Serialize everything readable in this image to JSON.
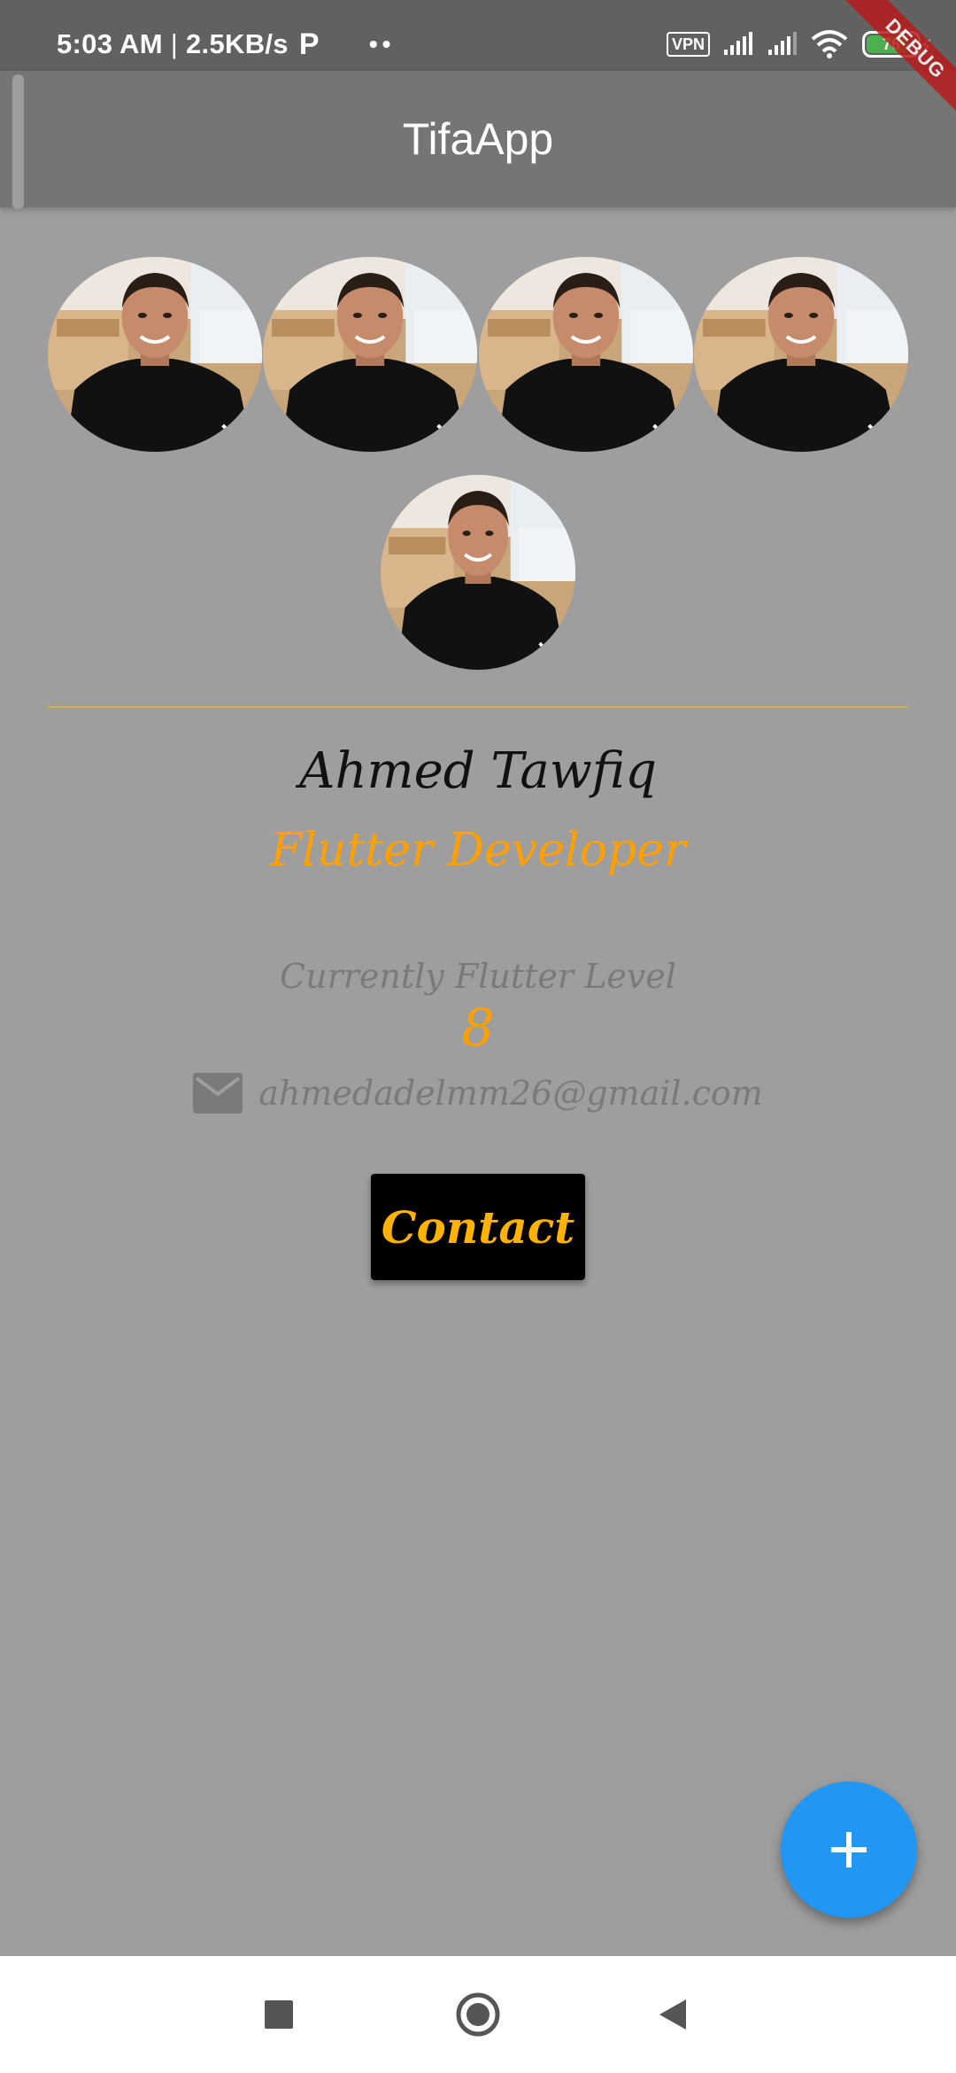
{
  "status_bar": {
    "time": "5:03 AM",
    "separator": " | ",
    "speed": "2.5KB/s",
    "app_glyph": "P",
    "dots": "••",
    "vpn": "VPN",
    "battery_level": "76",
    "battery_fill_percent": 76,
    "icons": [
      "p-app-icon",
      "signal-icon",
      "signal-icon",
      "wifi-icon",
      "battery-icon",
      "charging-icon"
    ]
  },
  "debug_banner": "DEBUG",
  "app_bar": {
    "title": "TifaApp"
  },
  "profile": {
    "avatar_count": 5,
    "name": "Ahmed Tawfiq",
    "role": "Flutter Developer",
    "level_label": "Currently Flutter Level",
    "level_value": "8",
    "email": "ahmedadelmm26@gmail.com"
  },
  "actions": {
    "contact_label": "Contact",
    "fab_icon": "plus-icon"
  },
  "nav_bar": {
    "icons": [
      "recent-apps-icon",
      "home-icon",
      "back-icon"
    ]
  },
  "colors": {
    "background": "#9e9e9e",
    "status_bar": "#616161",
    "app_bar": "#757575",
    "accent": "#ffa000",
    "fab": "#2196f3",
    "button": "#000000",
    "debug": "#b71c1c"
  }
}
